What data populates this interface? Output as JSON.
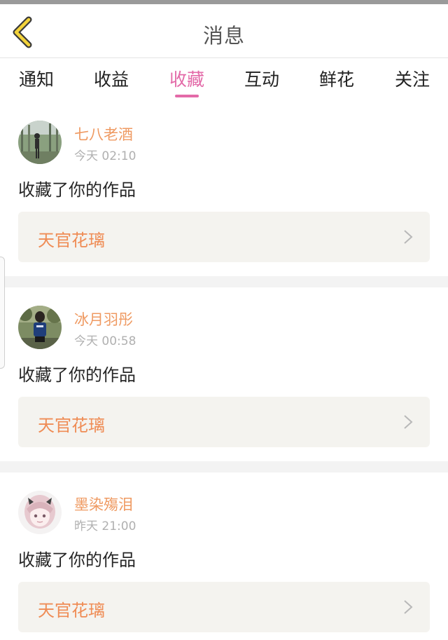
{
  "header": {
    "title": "消息"
  },
  "tabs": [
    {
      "label": "通知",
      "active": false
    },
    {
      "label": "收益",
      "active": false
    },
    {
      "label": "收藏",
      "active": true
    },
    {
      "label": "互动",
      "active": false
    },
    {
      "label": "鲜花",
      "active": false
    },
    {
      "label": "关注",
      "active": false
    }
  ],
  "colors": {
    "accent": "#e36aa8",
    "username": "#ef9a62",
    "work_title": "#ef8c55",
    "card_box": "#f4f3ef"
  },
  "notifications": [
    {
      "user": "七八老酒",
      "time": "今天 02:10",
      "action": "收藏了你的作品",
      "work": "天官花璃",
      "avatar_icon": "avatar-photo-outdoor-icon"
    },
    {
      "user": "冰月羽彤",
      "time": "今天 00:58",
      "action": "收藏了你的作品",
      "work": "天官花璃",
      "avatar_icon": "avatar-photo-person-icon"
    },
    {
      "user": "墨染殤泪",
      "time": "昨天 21:00",
      "action": "收藏了你的作品",
      "work": "天官花璃",
      "avatar_icon": "avatar-anime-girl-icon"
    }
  ]
}
